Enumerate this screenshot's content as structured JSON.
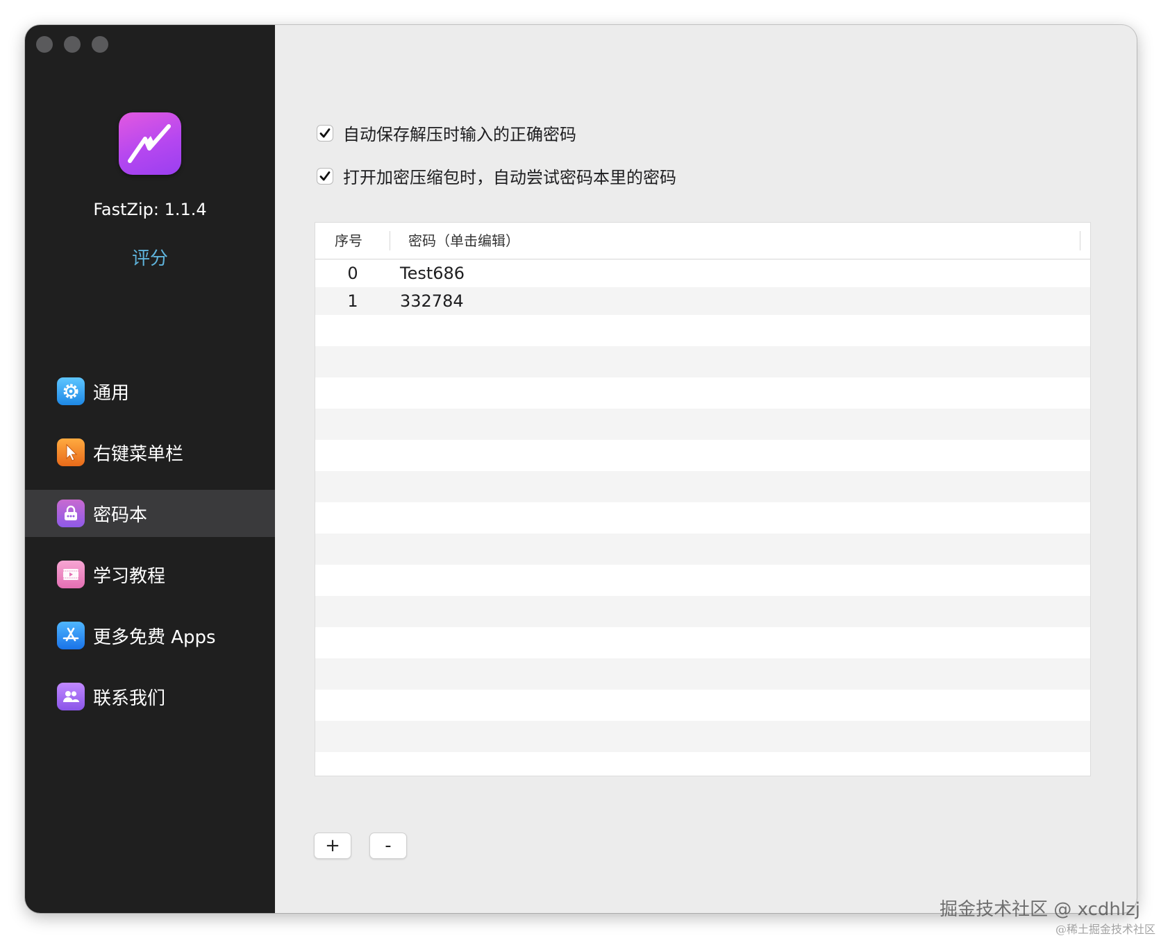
{
  "window": {
    "traffic_lights": [
      "close",
      "minimize",
      "zoom"
    ]
  },
  "sidebar": {
    "app_icon": "lightning-icon",
    "version": "FastZip: 1.1.4",
    "rate_label": "评分",
    "items": [
      {
        "label": "通用",
        "icon": "gear-icon",
        "active": false
      },
      {
        "label": "右键菜单栏",
        "icon": "cursor-icon",
        "active": false
      },
      {
        "label": "密码本",
        "icon": "lock-icon",
        "active": true
      },
      {
        "label": "学习教程",
        "icon": "video-icon",
        "active": false
      },
      {
        "label": "更多免费 Apps",
        "icon": "app-store-icon",
        "active": false
      },
      {
        "label": "联系我们",
        "icon": "people-icon",
        "active": false
      }
    ]
  },
  "main": {
    "options": [
      {
        "label": "自动保存解压时输入的正确密码",
        "checked": true
      },
      {
        "label": "打开加密压缩包时，自动尝试密码本里的密码",
        "checked": true
      }
    ],
    "table": {
      "headers": [
        "序号",
        "密码（单击编辑）"
      ],
      "rows": [
        {
          "index": "0",
          "password": "Test686"
        },
        {
          "index": "1",
          "password": "332784"
        }
      ]
    },
    "add_button": "+",
    "remove_button": "-"
  },
  "watermark": {
    "primary": "掘金技术社区 @ xcdhlzj",
    "secondary": "@稀土掘金技术社区"
  }
}
